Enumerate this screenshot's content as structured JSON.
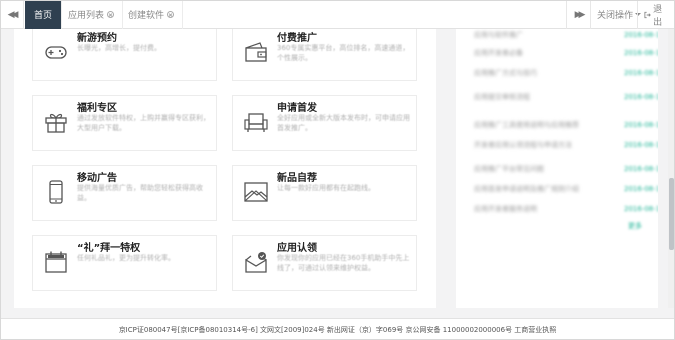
{
  "tabs": [
    {
      "label": "首页",
      "closable": false,
      "active": true
    },
    {
      "label": "应用列表",
      "closable": true,
      "active": false
    },
    {
      "label": "创建软件",
      "closable": true,
      "active": false
    }
  ],
  "toolbar": {
    "close_ops_label": "关闭操作",
    "exit_label": "退出"
  },
  "cards": [
    {
      "title": "新游预约",
      "desc": "长曝光，高增长，提付费。",
      "icon": "gamepad-icon"
    },
    {
      "title": "付费推广",
      "desc": "360专属实惠平台，高位排名，高速通道，个性展示。",
      "icon": "wallet-icon"
    },
    {
      "title": "福利专区",
      "desc": "通过发放软件特权，上购并赢得专区获利，大型用户下载。",
      "icon": "gift-icon"
    },
    {
      "title": "申请首发",
      "desc": "全好应用或全新大版本发布时，可申请应用首发推广。",
      "icon": "sofa-icon"
    },
    {
      "title": "移动广告",
      "desc": "提供海量优质广告，帮助您轻松获得高收益。",
      "icon": "phone-icon"
    },
    {
      "title": "新品自荐",
      "desc": "让每一款好应用都有在起跑线。",
      "icon": "image-icon"
    },
    {
      "title": "“礼”拜一特权",
      "desc": "任何礼品礼，更为提升转化率。",
      "icon": "calendar-icon"
    },
    {
      "title": "应用认领",
      "desc": "你发现你的应用已经在360手机助手中先上线了，可通过认领来维护权益。",
      "icon": "claim-icon"
    }
  ],
  "side_items": [
    {
      "text": "应用与软件推广",
      "tag": "2016-08-18"
    },
    {
      "text": "应用开发者必备",
      "tag": "2016-08-18"
    },
    {
      "text": "应用推广方式与技巧",
      "tag": "2016-08-18"
    },
    {
      "text": "应用提交审核流程",
      "tag": "2016-08-18"
    },
    {
      "text": "应用推广工具使用说明与应用推荐",
      "tag": "2016-08-18"
    },
    {
      "text": "开发者应用认领流程与申请方法",
      "tag": "2016-08-18"
    },
    {
      "text": "应用推广平台常见问题",
      "tag": "2016-08-18"
    },
    {
      "text": "应用首发申请说明及推广规则介绍",
      "tag": "2016-08-18"
    },
    {
      "text": "应用开发者服务说明",
      "tag": "2016-08-18"
    }
  ],
  "side_more": "更多",
  "footer": {
    "text": "京ICP证080047号[京ICP备08010314号-6] 文网文[2009]024号 新出网证（京）字069号 京公网安备 11000002000006号 工商营业执照"
  }
}
